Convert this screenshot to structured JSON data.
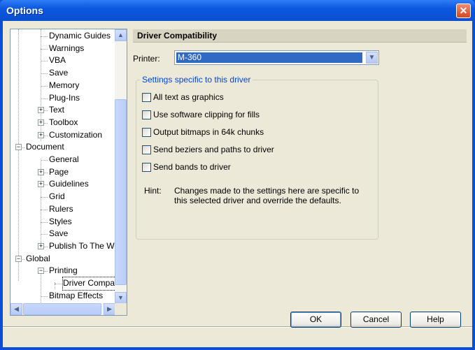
{
  "window": {
    "title": "Options"
  },
  "tree": {
    "items": [
      {
        "label": "Dynamic Guides",
        "level": 2,
        "expander": "none"
      },
      {
        "label": "Warnings",
        "level": 2,
        "expander": "none"
      },
      {
        "label": "VBA",
        "level": 2,
        "expander": "none"
      },
      {
        "label": "Save",
        "level": 2,
        "expander": "none"
      },
      {
        "label": "Memory",
        "level": 2,
        "expander": "none"
      },
      {
        "label": "Plug-Ins",
        "level": 2,
        "expander": "none"
      },
      {
        "label": "Text",
        "level": 2,
        "expander": "plus"
      },
      {
        "label": "Toolbox",
        "level": 2,
        "expander": "plus"
      },
      {
        "label": "Customization",
        "level": 2,
        "expander": "plus"
      },
      {
        "label": "Document",
        "level": 1,
        "expander": "minus"
      },
      {
        "label": "General",
        "level": 2,
        "expander": "none"
      },
      {
        "label": "Page",
        "level": 2,
        "expander": "plus"
      },
      {
        "label": "Guidelines",
        "level": 2,
        "expander": "plus"
      },
      {
        "label": "Grid",
        "level": 2,
        "expander": "none"
      },
      {
        "label": "Rulers",
        "level": 2,
        "expander": "none"
      },
      {
        "label": "Styles",
        "level": 2,
        "expander": "none"
      },
      {
        "label": "Save",
        "level": 2,
        "expander": "none"
      },
      {
        "label": "Publish To The We",
        "level": 2,
        "expander": "plus"
      },
      {
        "label": "Global",
        "level": 1,
        "expander": "minus"
      },
      {
        "label": "Printing",
        "level": 2,
        "expander": "minus"
      },
      {
        "label": "Driver Compat",
        "level": 3,
        "expander": "none",
        "selected": true
      },
      {
        "label": "Bitmap Effects",
        "level": 2,
        "expander": "none"
      }
    ]
  },
  "panel": {
    "header": "Driver Compatibility",
    "printer_label": "Printer:",
    "printer_value": "M-360",
    "group_label": "Settings specific to this driver",
    "options": [
      {
        "label": "All text as graphics",
        "checked": false
      },
      {
        "label": "Use software clipping for fills",
        "checked": false
      },
      {
        "label": "Output bitmaps in 64k chunks",
        "checked": false
      },
      {
        "label": "Send beziers and paths to driver",
        "checked": false
      },
      {
        "label": "Send bands to driver",
        "checked": false
      }
    ],
    "hint_label": "Hint:",
    "hint_text": "Changes made to the settings here are specific to this selected driver and override the defaults."
  },
  "buttons": {
    "ok": "OK",
    "cancel": "Cancel",
    "help": "Help"
  },
  "colors": {
    "titlebar": "#0a58e0",
    "selection": "#316ac5",
    "dialog_bg": "#ece9d8",
    "group_title": "#0046d5"
  }
}
